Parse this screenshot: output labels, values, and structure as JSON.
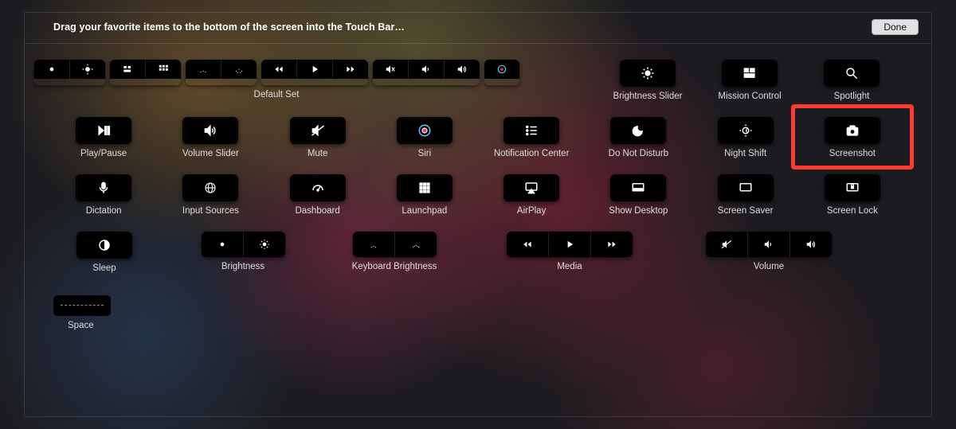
{
  "header": {
    "instruction": "Drag your favorite items to the bottom of the screen into the Touch Bar…",
    "done": "Done"
  },
  "row1": {
    "default_set": "Default Set",
    "brightness_slider": "Brightness Slider",
    "mission_control": "Mission Control",
    "spotlight": "Spotlight"
  },
  "row2": {
    "play_pause": "Play/Pause",
    "volume_slider": "Volume Slider",
    "mute": "Mute",
    "siri": "Siri",
    "notif_center": "Notification Center",
    "dnd": "Do Not Disturb",
    "night_shift": "Night Shift",
    "screenshot": "Screenshot"
  },
  "row3": {
    "dictation": "Dictation",
    "input_sources": "Input Sources",
    "dashboard": "Dashboard",
    "launchpad": "Launchpad",
    "airplay": "AirPlay",
    "show_desktop": "Show Desktop",
    "screen_saver": "Screen Saver",
    "screen_lock": "Screen Lock"
  },
  "row4": {
    "sleep": "Sleep",
    "brightness": "Brightness",
    "kbd_brightness": "Keyboard Brightness",
    "media": "Media",
    "volume": "Volume"
  },
  "row5": {
    "space": "Space"
  },
  "highlight": {
    "item": "screenshot",
    "color": "#ff3b30"
  }
}
